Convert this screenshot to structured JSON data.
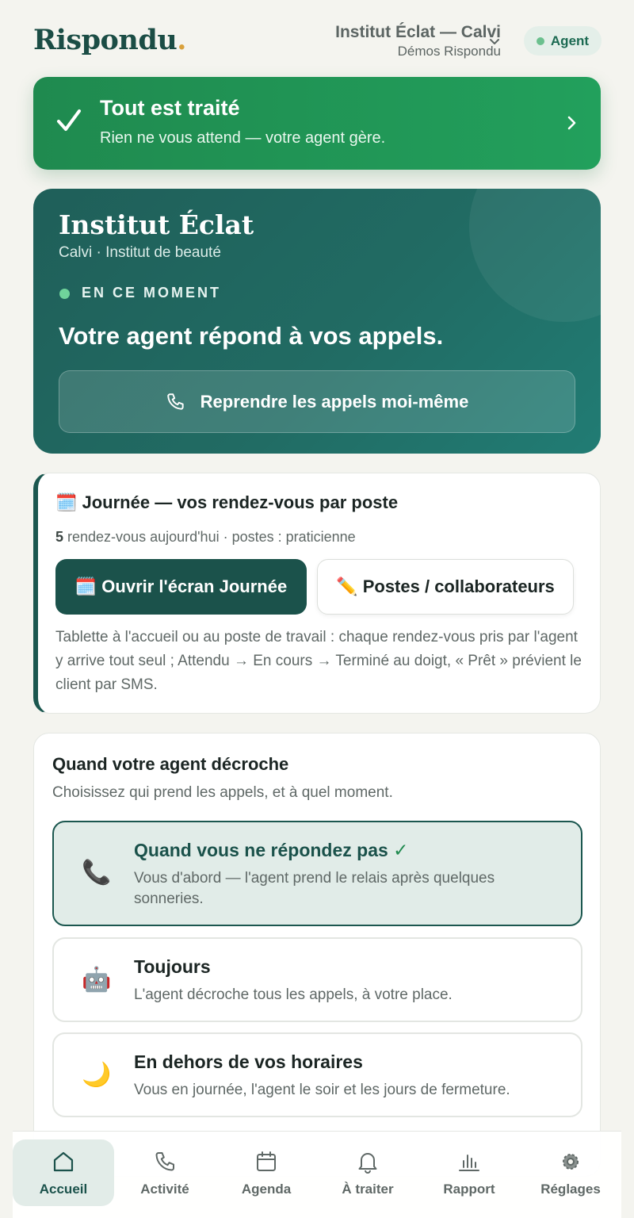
{
  "header": {
    "logo_text": "Rispondu",
    "logo_dot": ".",
    "business_name": "Institut Éclat — Calvi",
    "business_sub": "Démos Rispondu",
    "agent_badge": "Agent"
  },
  "banner": {
    "title": "Tout est traité",
    "subtitle": "Rien ne vous attend — votre agent gère."
  },
  "hero": {
    "name": "Institut Éclat",
    "subtitle": "Calvi · Institut de beauté",
    "live_label": "EN CE MOMENT",
    "status": "Votre agent répond à vos appels.",
    "take_calls_button": "Reprendre les appels moi-même"
  },
  "day": {
    "title": "🗓️ Journée — vos rendez-vous par poste",
    "count": "5",
    "meta_rest": " rendez-vous aujourd'hui · postes : praticienne",
    "open_button": "🗓️ Ouvrir l'écran Journée",
    "staff_button": "✏️ Postes / collaborateurs",
    "description": "Tablette à l'accueil ou au poste de travail : chaque rendez-vous pris par l'agent y arrive tout seul ; Attendu → En cours → Terminé au doigt, « Prêt » prévient le client par SMS."
  },
  "modes": {
    "title": "Quand votre agent décroche",
    "subtitle": "Choisissez qui prend les appels, et à quel moment.",
    "options": [
      {
        "icon": "📞",
        "title": "Quand vous ne répondez pas",
        "check": "✓",
        "desc": "Vous d'abord — l'agent prend le relais après quelques sonneries.",
        "selected": true
      },
      {
        "icon": "🤖",
        "title": "Toujours",
        "desc": "L'agent décroche tous les appels, à votre place.",
        "selected": false
      },
      {
        "icon": "🌙",
        "title": "En dehors de vos horaires",
        "desc": "Vous en journée, l'agent le soir et les jours de fermeture.",
        "selected": false
      }
    ]
  },
  "nav": {
    "items": [
      {
        "label": "Accueil",
        "icon": "home-icon",
        "active": true
      },
      {
        "label": "Activité",
        "icon": "phone-icon",
        "active": false
      },
      {
        "label": "Agenda",
        "icon": "calendar-icon",
        "active": false
      },
      {
        "label": "À traiter",
        "icon": "bell-icon",
        "active": false
      },
      {
        "label": "Rapport",
        "icon": "chart-icon",
        "active": false
      },
      {
        "label": "Réglages",
        "icon": "gear-icon",
        "active": false
      }
    ]
  },
  "colors": {
    "brand": "#1b524b",
    "banner_green": "#22a05c",
    "accent_gold": "#d9a13c",
    "page_bg": "#f4f4ef"
  }
}
